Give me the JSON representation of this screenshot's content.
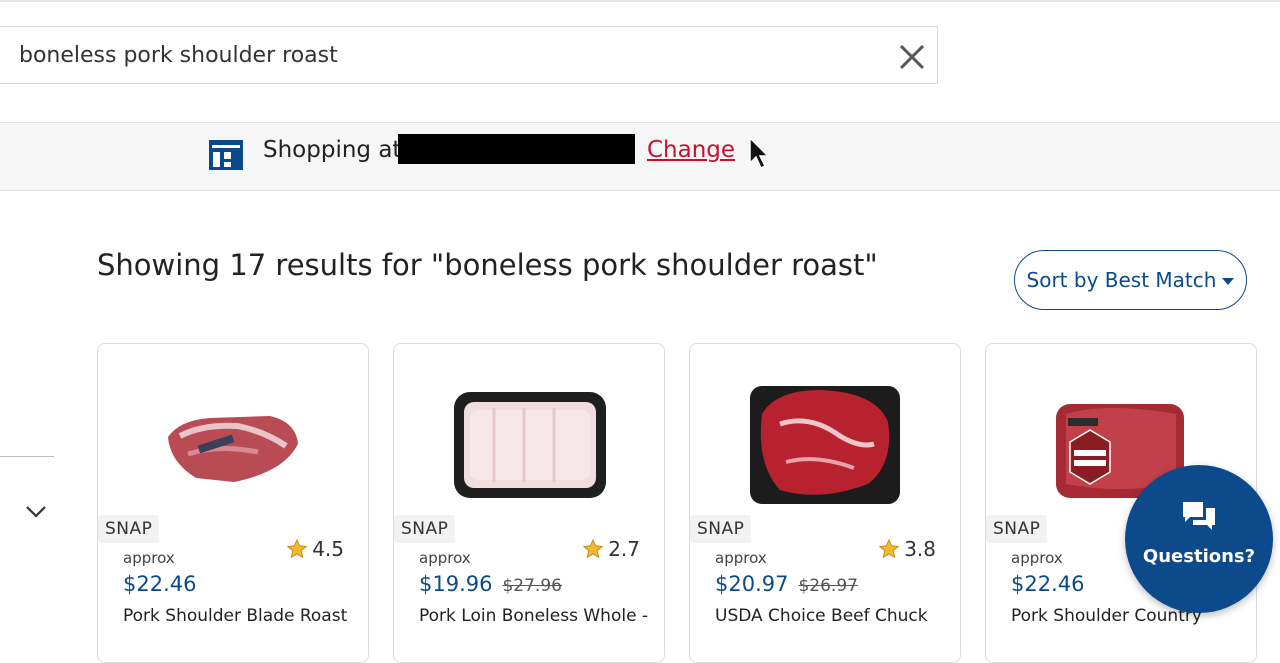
{
  "search": {
    "query": "boneless pork shoulder roast"
  },
  "store_bar": {
    "shopping_label": "Shopping at",
    "change_label": "Change"
  },
  "results": {
    "heading": "Showing 17 results for \"boneless pork shoulder roast\"",
    "sort_label": "Sort by Best Match"
  },
  "products": [
    {
      "badge": "SNAP",
      "approx_label": "approx",
      "rating": "4.5",
      "price": "$22.46",
      "old_price": "",
      "name": "Pork Shoulder Blade Roast"
    },
    {
      "badge": "SNAP",
      "approx_label": "approx",
      "rating": "2.7",
      "price": "$19.96",
      "old_price": "$27.96",
      "name": "Pork Loin Boneless Whole -"
    },
    {
      "badge": "SNAP",
      "approx_label": "approx",
      "rating": "3.8",
      "price": "$20.97",
      "old_price": "$26.97",
      "name": "USDA Choice Beef Chuck"
    },
    {
      "badge": "SNAP",
      "approx_label": "approx",
      "rating": "",
      "price": "$22.46",
      "old_price": "",
      "name": "Pork Shoulder Country"
    }
  ],
  "questions": {
    "label": "Questions?"
  },
  "colors": {
    "brand_blue": "#0a4a8a",
    "link_red": "#c8102e",
    "star_gold": "#f5b82e"
  },
  "icons": [
    "close-icon",
    "store-icon",
    "chevron-down-icon",
    "star-icon",
    "chat-icon",
    "mouse-cursor"
  ]
}
